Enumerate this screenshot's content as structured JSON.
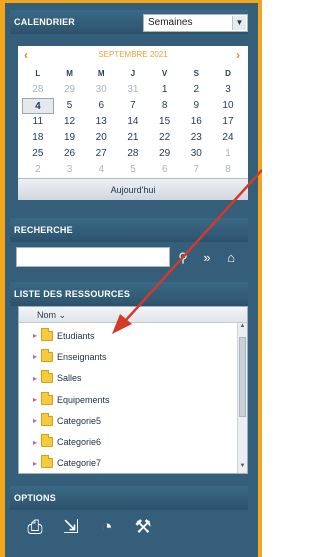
{
  "calendar": {
    "header": "CALENDRIER",
    "view_select": "Semaines",
    "month_label": "SEPTEMBRE 2021",
    "prev": "‹",
    "next": "›",
    "weekdays": [
      "L",
      "M",
      "M",
      "J",
      "V",
      "S",
      "D"
    ],
    "weeks": [
      [
        "28",
        "29",
        "30",
        "31",
        "1",
        "2",
        "3"
      ],
      [
        "4",
        "5",
        "6",
        "7",
        "8",
        "9",
        "10"
      ],
      [
        "11",
        "12",
        "13",
        "14",
        "15",
        "16",
        "17"
      ],
      [
        "18",
        "19",
        "20",
        "21",
        "22",
        "23",
        "24"
      ],
      [
        "25",
        "26",
        "27",
        "28",
        "29",
        "30",
        "1"
      ],
      [
        "2",
        "3",
        "4",
        "5",
        "6",
        "7",
        "8"
      ]
    ],
    "today_button": "Aujourd'hui"
  },
  "search": {
    "header": "RECHERCHE",
    "input_value": "",
    "icons": [
      "search-icon",
      "forward-icon",
      "home-icon"
    ]
  },
  "resources": {
    "header": "LISTE DES RESSOURCES",
    "column_header": "Nom",
    "items": [
      "Etudiants",
      "Enseignants",
      "Salles",
      "Equipements",
      "Categorie5",
      "Categorie6",
      "Categorie7"
    ]
  },
  "options": {
    "header": "OPTIONS",
    "icons": [
      "print-icon",
      "export-icon",
      "rss-icon",
      "tool-icon"
    ]
  },
  "colors": {
    "frame": "#f3a51c",
    "panel": "#345e79",
    "accent_arrow": "#d43a2a"
  }
}
